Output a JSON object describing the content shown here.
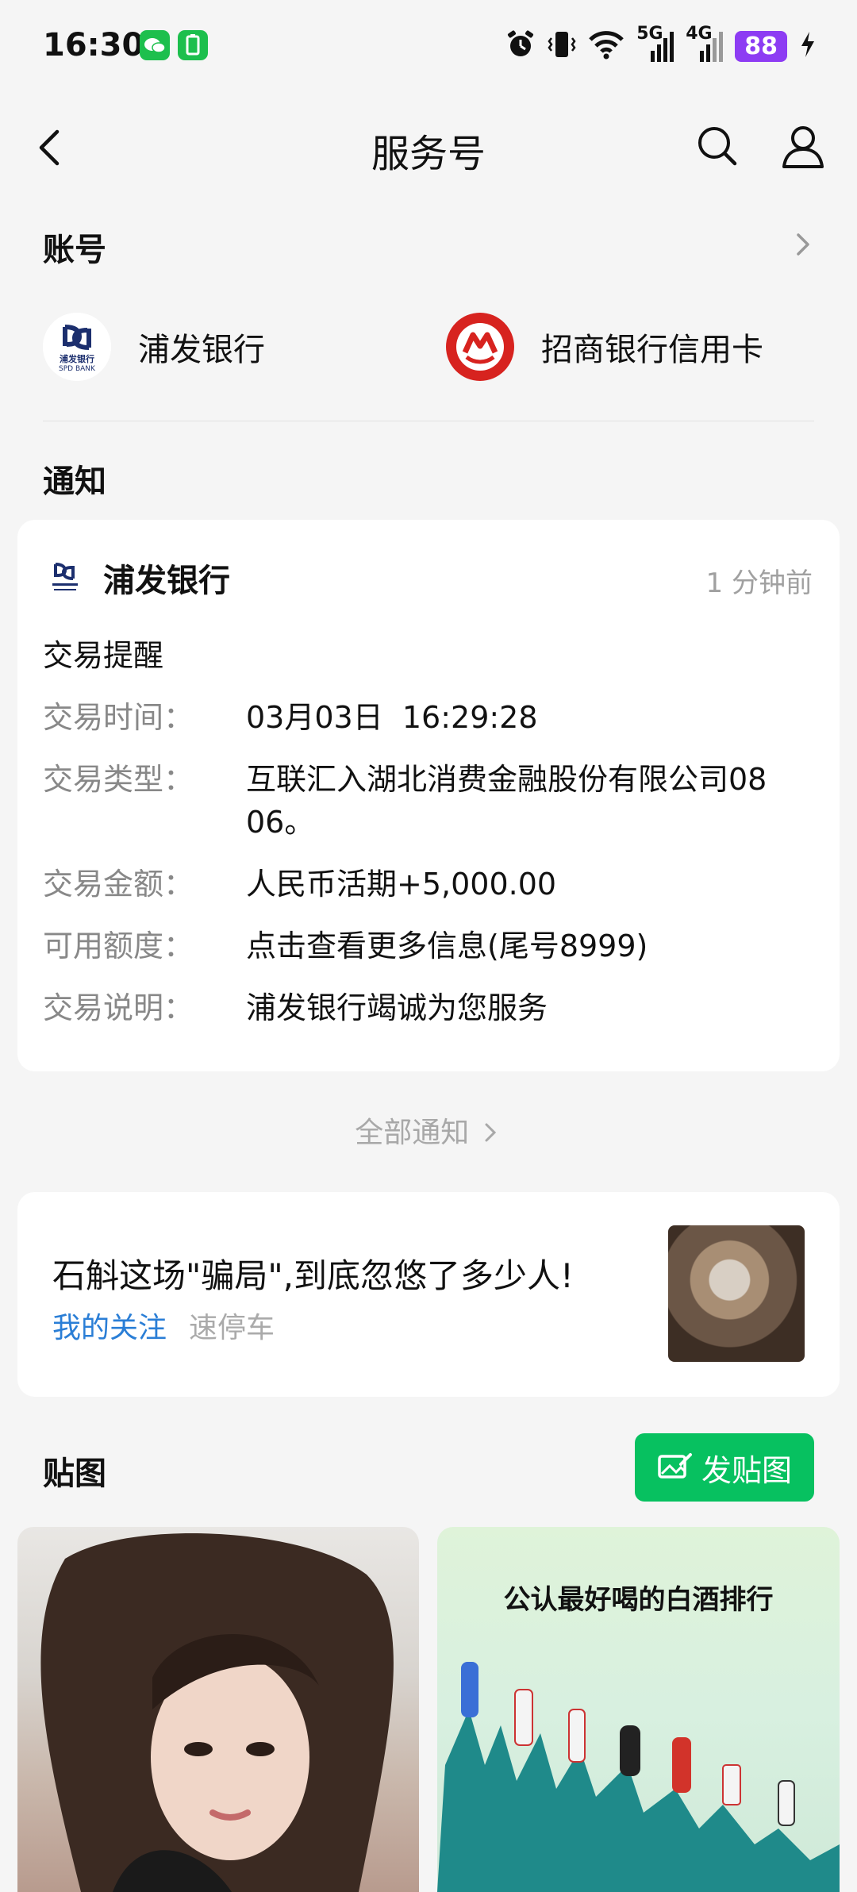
{
  "status_bar": {
    "time": "16:30",
    "battery": "88",
    "net1": "5G",
    "net2": "4G"
  },
  "nav": {
    "title": "服务号"
  },
  "accounts": {
    "title": "账号",
    "items": [
      {
        "name": "浦发银行",
        "logo_caption": "浦发银行",
        "logo_sub": "SPD BANK"
      },
      {
        "name": "招商银行信用卡"
      }
    ]
  },
  "notices": {
    "title": "通知",
    "card": {
      "bank": "浦发银行",
      "time_ago": "1 分钟前",
      "heading": "交易提醒",
      "rows": [
        {
          "label": "交易时间：",
          "value": "03月03日  16:29:28"
        },
        {
          "label": "交易类型：",
          "value": "互联汇入湖北消费金融股份有限公司0806。"
        },
        {
          "label": "交易金额：",
          "value": "人民币活期+5,000.00"
        },
        {
          "label": "可用额度：",
          "value": "点击查看更多信息(尾号8999)"
        },
        {
          "label": "交易说明：",
          "value": "浦发银行竭诚为您服务"
        }
      ]
    },
    "all_label": "全部通知"
  },
  "article": {
    "title": "石斛这场\"骗局\",到底忽悠了多少人!",
    "follow": "我的关注",
    "source": "速停车"
  },
  "stickers": {
    "title": "贴图",
    "post_button": "发贴图",
    "tile2_title": "公认最好喝的白酒排行"
  },
  "colors": {
    "wechat_green": "#07c160",
    "link_blue": "#2a7ed6",
    "battery_purple": "#8d3cf3"
  }
}
